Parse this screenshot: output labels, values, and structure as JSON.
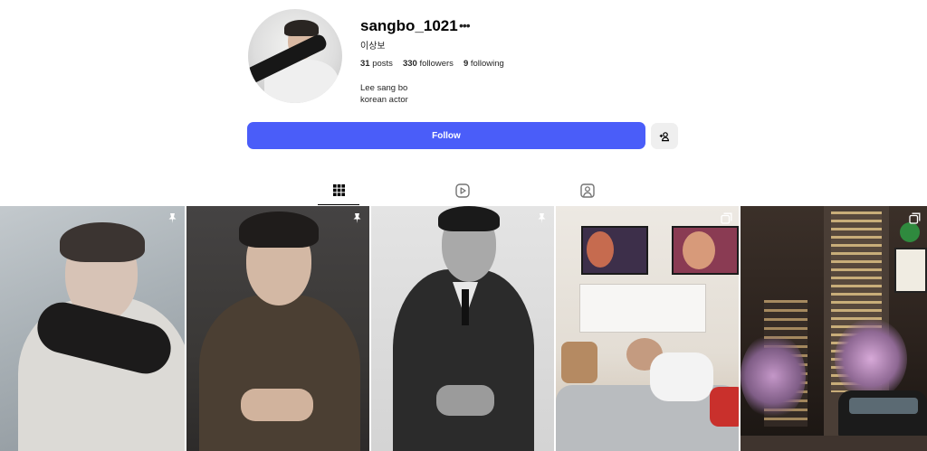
{
  "profile": {
    "username": "sangbo_1021",
    "full_name": "이상보",
    "stats": {
      "posts_count": "31",
      "posts_label": "posts",
      "followers_count": "330",
      "followers_label": "followers",
      "following_count": "9",
      "following_label": "following"
    },
    "bio": [
      "Lee sang bo",
      "korean actor"
    ],
    "more_icon": "more-horizontal-icon"
  },
  "actions": {
    "follow_label": "Follow",
    "suggest_icon": "add-person-icon"
  },
  "tabs": [
    {
      "name": "posts",
      "icon": "grid-icon",
      "active": true
    },
    {
      "name": "reels",
      "icon": "reels-icon",
      "active": false
    },
    {
      "name": "tagged",
      "icon": "tagged-icon",
      "active": false
    }
  ],
  "posts": [
    {
      "badge_icon": "pin-icon",
      "pinned": true
    },
    {
      "badge_icon": "pin-icon",
      "pinned": true
    },
    {
      "badge_icon": "pin-icon",
      "pinned": true
    },
    {
      "badge_icon": "carousel-icon",
      "pinned": false
    },
    {
      "badge_icon": "carousel-icon",
      "pinned": false
    }
  ],
  "colors": {
    "follow_button": "#4a5df9",
    "suggest_button": "#efefef",
    "text": "#262626"
  }
}
